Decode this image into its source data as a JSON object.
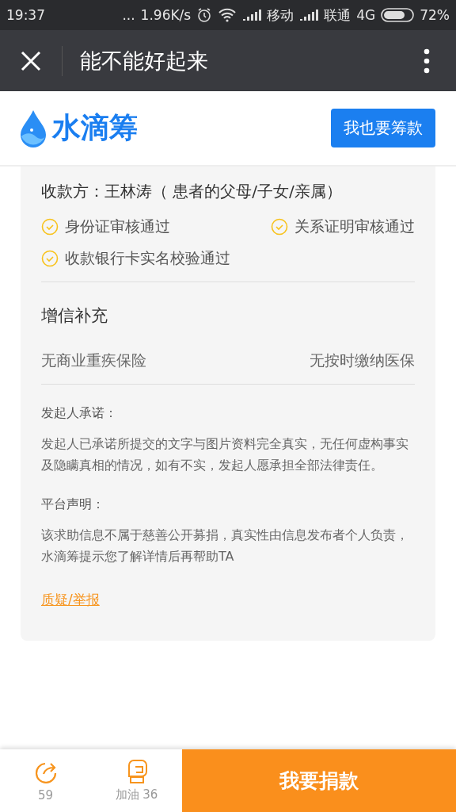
{
  "status_bar": {
    "time": "19:37",
    "dots": "...",
    "speed": "1.96K/s",
    "carrier_1": "移动",
    "carrier_2": "联通",
    "network": "4G",
    "battery": "72%"
  },
  "nav": {
    "title": "能不能好起来"
  },
  "header": {
    "logo_text": "水滴筹",
    "button": "我也要筹款"
  },
  "payee": "收款方：王林涛（ 患者的父母/子女/亲属）",
  "verifications": [
    {
      "label": "身份证审核通过",
      "checked": true
    },
    {
      "label": "关系证明审核通过",
      "checked": true
    },
    {
      "label": "收款银行卡实名校验通过",
      "checked": true
    }
  ],
  "credit": {
    "title": "增信补充",
    "items": [
      "无商业重疾保险",
      "无按时缴纳医保"
    ]
  },
  "notes": [
    {
      "heading": "发起人承诺：",
      "body": "发起人已承诺所提交的文字与图片资料完全真实，无任何虚构事实及隐瞒真相的情况，如有不实，发起人愿承担全部法律责任。"
    },
    {
      "heading": "平台声明：",
      "body": "该求助信息不属于慈善公开募捐，真实性由信息发布者个人负责，水滴筹提示您了解详情后再帮助TA"
    }
  ],
  "report_link": "质疑/举报",
  "bottom_bar": {
    "share_count": "59",
    "cheer": "加油 36",
    "donate": "我要捐款"
  }
}
